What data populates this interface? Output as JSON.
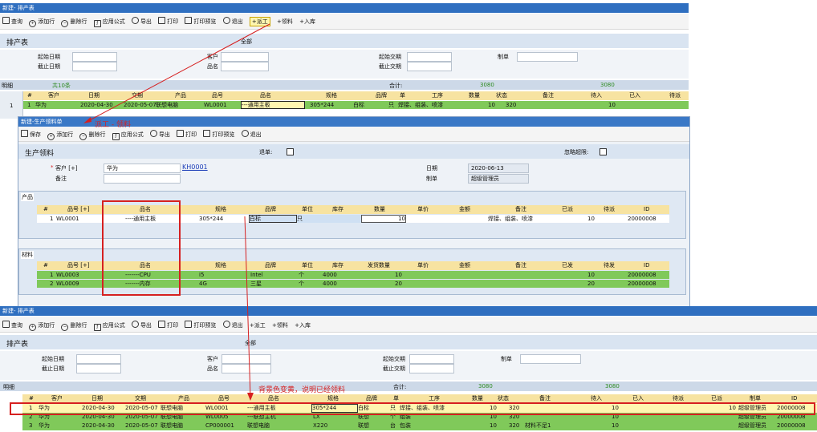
{
  "top": {
    "title": "新建- 排产表",
    "toolbar": [
      "查询",
      "添加行",
      "删除行",
      "应用公式",
      "导出",
      "打印",
      "打印预览",
      "退出",
      "+派工",
      "+领料",
      "+入库"
    ],
    "form_title": "排产表",
    "scope": "全部",
    "labels": {
      "start": "起始日期",
      "end": "截止日期",
      "customer": "客户",
      "product": "品名",
      "start_delivery": "起始交期",
      "end_delivery": "截止交期",
      "maker": "制单"
    },
    "detail_label": "明细",
    "count": "共10条",
    "total_label": "合计:",
    "total_qty": "3080",
    "total_pending": "3080",
    "columns": [
      "#",
      "客户",
      "日期",
      "交期",
      "产品",
      "品号",
      "品名",
      "规格",
      "品牌",
      "单",
      "工序",
      "数量",
      "状态",
      "备注",
      "待入",
      "已入",
      "待派"
    ],
    "row": [
      "1",
      "华为",
      "2020-04-30",
      "2020-05-07",
      "联想电脑",
      "WL0001",
      "---通用主板",
      "305*244",
      "白标",
      "只",
      "焊接、组装、喷漆",
      "10",
      "320",
      "",
      "10",
      "",
      ""
    ]
  },
  "annotation1": "派工 - 领料",
  "mid": {
    "title": "新建-生产领料单",
    "toolbar": [
      "保存",
      "添加行",
      "删除行",
      "应用公式",
      "导出",
      "打印",
      "打印预览",
      "退出"
    ],
    "form_title": "生产领料",
    "checkbox1": "退单:",
    "checkbox2": "忽略超限:",
    "customer_label": "客户 [+]",
    "customer_value": "华为",
    "customer_code": "KH0001",
    "remark_label": "备注",
    "date_label": "日期",
    "date_value": "2020-06-13",
    "maker_label": "制单",
    "maker_value": "超级管理员",
    "product_section": "产品",
    "product_columns": [
      "#",
      "品号 [+]",
      "品名",
      "规格",
      "品牌",
      "单位",
      "库存",
      "数量",
      "单价",
      "金额",
      "备注",
      "已派",
      "待派",
      "ID"
    ],
    "product_row": [
      "1",
      "WL0001",
      "----通用主板",
      "305*244",
      "白标",
      "只",
      "",
      "10",
      "",
      "",
      "焊接、组装、喷漆",
      "",
      "10",
      "20000008"
    ],
    "material_section": "材料",
    "material_columns": [
      "#",
      "品号 [+]",
      "品名",
      "规格",
      "品牌",
      "单位",
      "库存",
      "发货数量",
      "单价",
      "金额",
      "备注",
      "已发",
      "待发",
      "ID"
    ],
    "material_rows": [
      [
        "1",
        "WL0003",
        "-------CPU",
        "i5",
        "Intel",
        "个",
        "4000",
        "10",
        "",
        "",
        "",
        "",
        "10",
        "20000008"
      ],
      [
        "2",
        "WL0009",
        "-------内存",
        "4G",
        "三星",
        "个",
        "4000",
        "20",
        "",
        "",
        "",
        "",
        "20",
        "20000008"
      ]
    ]
  },
  "bottom": {
    "title": "新建- 排产表",
    "toolbar": [
      "查询",
      "添加行",
      "删除行",
      "应用公式",
      "导出",
      "打印",
      "打印预览",
      "退出",
      "+派工",
      "+领料",
      "+入库"
    ],
    "form_title": "排产表",
    "scope": "全部",
    "detail_label": "明细",
    "total_label": "合计:",
    "total_qty": "3080",
    "total_pending": "3080",
    "columns": [
      "#",
      "客户",
      "日期",
      "交期",
      "产品",
      "品号",
      "品名",
      "规格",
      "品牌",
      "单",
      "工序",
      "数量",
      "状态",
      "备注",
      "待入",
      "已入",
      "待派",
      "已派",
      "制单",
      "ID"
    ],
    "rows": [
      [
        "1",
        "华为",
        "2020-04-30",
        "2020-05-07",
        "联想电脑",
        "WL0001",
        "---通用主板",
        "305*244",
        "白标",
        "只",
        "焊接、组装、喷漆",
        "10",
        "320",
        "",
        "10",
        "",
        "",
        "10",
        "超级管理员",
        "20000008"
      ],
      [
        "2",
        "华为",
        "2020-04-30",
        "2020-05-07",
        "联想电脑",
        "WL0005",
        "---联想主机",
        "LX",
        "联想",
        "个",
        "组装",
        "10",
        "320",
        "",
        "10",
        "",
        "",
        "",
        "超级管理员",
        "20000008"
      ],
      [
        "3",
        "华为",
        "2020-04-30",
        "2020-05-07",
        "联想电脑",
        "CP000001",
        "联想电脑",
        "X220",
        "联想",
        "台",
        "包装",
        "10",
        "320",
        "材料不足1",
        "10",
        "",
        "",
        "",
        "超级管理员",
        "20000008"
      ]
    ]
  },
  "annotation2": "背景色变黄，说明已经领料",
  "colors": {
    "title": "#2f6fc0",
    "band": "#d9e4f1",
    "header": "#f7e3a1",
    "row_green": "#80c95a",
    "row_yellow": "#fff6b0",
    "annotation": "#d62020"
  }
}
